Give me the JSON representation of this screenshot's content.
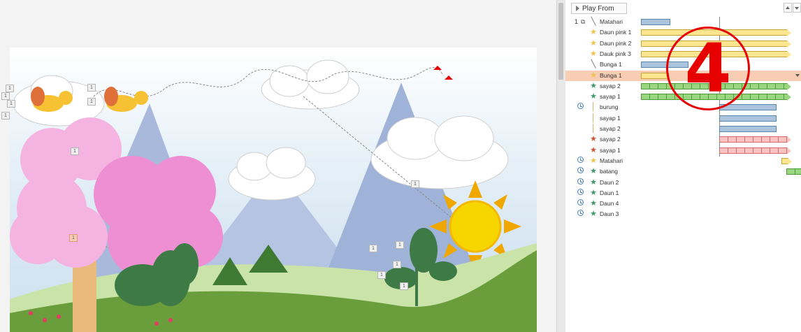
{
  "animation_pane": {
    "play_from_label": "Play From",
    "rows": [
      {
        "num": "1",
        "trigger": "Ɑ",
        "effect": "line",
        "label": "Matahari",
        "bar_color": "blue",
        "bar_start": 108,
        "bar_width": 42,
        "arrow": false,
        "selected": false,
        "clock": false
      },
      {
        "num": "",
        "trigger": "",
        "effect": "star-yellow",
        "label": "Daun pink 1",
        "bar_color": "yellow",
        "bar_start": 108,
        "bar_width": 210,
        "arrow": true,
        "selected": false,
        "clock": false
      },
      {
        "num": "",
        "trigger": "",
        "effect": "star-yellow",
        "label": "Daun pink 2",
        "bar_color": "yellow",
        "bar_start": 108,
        "bar_width": 210,
        "arrow": true,
        "selected": false,
        "clock": false
      },
      {
        "num": "",
        "trigger": "",
        "effect": "star-yellow",
        "label": "Dauk pink 3",
        "bar_color": "yellow",
        "bar_start": 108,
        "bar_width": 210,
        "arrow": true,
        "selected": false,
        "clock": false
      },
      {
        "num": "",
        "trigger": "",
        "effect": "line",
        "label": "Bunga 1",
        "bar_color": "blue",
        "bar_start": 108,
        "bar_width": 68,
        "arrow": false,
        "selected": false,
        "clock": false
      },
      {
        "num": "",
        "trigger": "",
        "effect": "star-yellow",
        "label": "Bunga 1",
        "bar_color": "yellow",
        "bar_start": 108,
        "bar_width": 40,
        "arrow": false,
        "selected": true,
        "clock": false
      },
      {
        "num": "",
        "trigger": "",
        "effect": "star-green",
        "label": "sayap 2",
        "bar_color": "green",
        "bar_start": 108,
        "bar_width": 210,
        "arrow": true,
        "selected": false,
        "clock": false
      },
      {
        "num": "",
        "trigger": "",
        "effect": "star-green",
        "label": "sayap 1",
        "bar_color": "green",
        "bar_start": 108,
        "bar_width": 210,
        "arrow": true,
        "selected": false,
        "clock": false
      },
      {
        "num": "",
        "trigger": "",
        "effect": "motion",
        "label": "burung",
        "bar_color": "blue",
        "bar_start": 220,
        "bar_width": 82,
        "arrow": false,
        "selected": false,
        "clock": true
      },
      {
        "num": "",
        "trigger": "",
        "effect": "motion",
        "label": "sayap 1",
        "bar_color": "blue",
        "bar_start": 220,
        "bar_width": 82,
        "arrow": false,
        "selected": false,
        "clock": false
      },
      {
        "num": "",
        "trigger": "",
        "effect": "motion",
        "label": "sayap 2",
        "bar_color": "blue",
        "bar_start": 220,
        "bar_width": 82,
        "arrow": false,
        "selected": false,
        "clock": false
      },
      {
        "num": "",
        "trigger": "",
        "effect": "star-red",
        "label": "sayap 2",
        "bar_color": "red",
        "bar_start": 220,
        "bar_width": 98,
        "arrow": true,
        "selected": false,
        "clock": false
      },
      {
        "num": "",
        "trigger": "",
        "effect": "star-red",
        "label": "sayap 1",
        "bar_color": "red",
        "bar_start": 220,
        "bar_width": 98,
        "arrow": true,
        "selected": false,
        "clock": false
      },
      {
        "num": "",
        "trigger": "",
        "effect": "star-yellow",
        "label": "Matahari",
        "bar_color": "yellow",
        "bar_start": 309,
        "bar_width": 10,
        "arrow": true,
        "selected": false,
        "clock": true
      },
      {
        "num": "",
        "trigger": "",
        "effect": "star-green",
        "label": "batang",
        "bar_color": "green",
        "bar_start": 316,
        "bar_width": 30,
        "arrow": false,
        "selected": false,
        "clock": true
      },
      {
        "num": "",
        "trigger": "",
        "effect": "star-green",
        "label": "Daun 2",
        "bar_color": "",
        "bar_start": 0,
        "bar_width": 0,
        "arrow": false,
        "selected": false,
        "clock": true
      },
      {
        "num": "",
        "trigger": "",
        "effect": "star-green",
        "label": "Daun 1",
        "bar_color": "",
        "bar_start": 0,
        "bar_width": 0,
        "arrow": false,
        "selected": false,
        "clock": true
      },
      {
        "num": "",
        "trigger": "",
        "effect": "star-green",
        "label": "Daun 4",
        "bar_color": "",
        "bar_start": 0,
        "bar_width": 0,
        "arrow": false,
        "selected": false,
        "clock": true
      },
      {
        "num": "",
        "trigger": "",
        "effect": "star-green",
        "label": "Daun 3",
        "bar_color": "",
        "bar_start": 0,
        "bar_width": 0,
        "arrow": false,
        "selected": false,
        "clock": true
      }
    ]
  },
  "annotation": {
    "step_number": "4"
  },
  "slide": {
    "tags": [
      "1",
      "1",
      "1",
      "1",
      "1",
      "1",
      "1",
      "1",
      "1",
      "1",
      "1",
      "1",
      "1",
      "1"
    ]
  },
  "colors": {
    "accent_red": "#e60000",
    "selected_row": "#f9ccb4",
    "bar_blue": "#a9c4dc",
    "bar_yellow": "#fde68f",
    "bar_green": "#9ad67f",
    "bar_red": "#fbc2c2"
  }
}
